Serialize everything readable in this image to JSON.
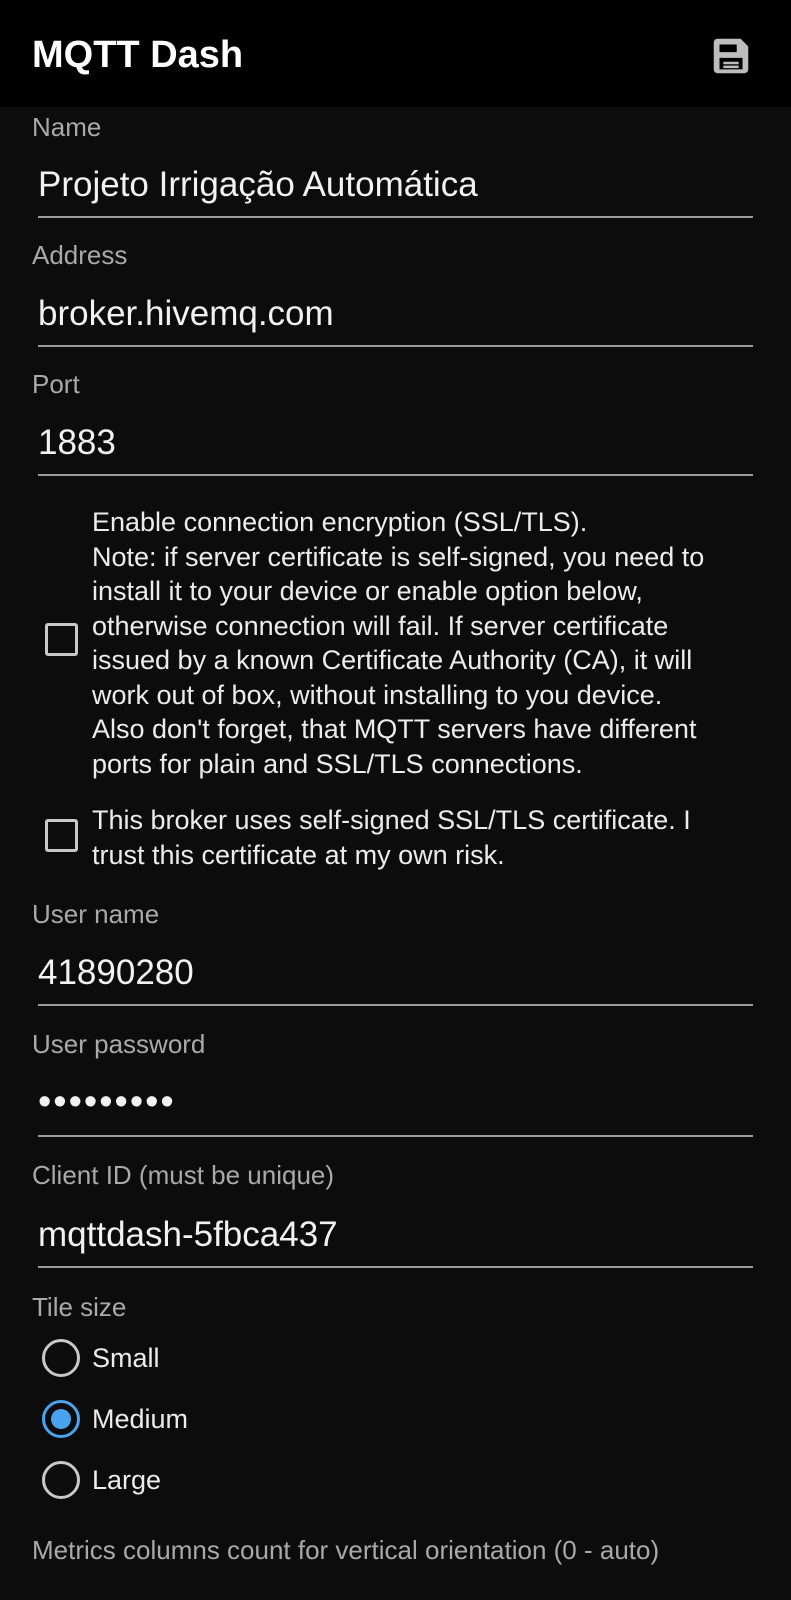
{
  "appbar": {
    "title": "MQTT Dash",
    "save_icon": "save-icon"
  },
  "form": {
    "name": {
      "label": "Name",
      "value": "Projeto Irrigação Automática"
    },
    "address": {
      "label": "Address",
      "value": "broker.hivemq.com"
    },
    "port": {
      "label": "Port",
      "value": "1883"
    },
    "ssl": {
      "checked": false,
      "lines": [
        "Enable connection encryption (SSL/TLS).",
        "Note: if server certificate is self-signed, you need to",
        "install it to your device or enable option below,",
        "otherwise connection will fail. If server certificate",
        "issued by a known Certificate Authority (CA), it will",
        "work out of box, without installing to you device.",
        "Also don't forget, that MQTT servers have different",
        "ports for plain and SSL/TLS connections."
      ]
    },
    "self_signed": {
      "checked": false,
      "lines": [
        "This broker uses self-signed SSL/TLS certificate. I",
        "trust this certificate at my own risk."
      ]
    },
    "username": {
      "label": "User name",
      "value": "41890280"
    },
    "password": {
      "label": "User password",
      "value": "•••••••••"
    },
    "client_id": {
      "label": "Client ID (must be unique)",
      "value": "mqttdash-5fbca437"
    },
    "tile_size": {
      "label": "Tile size",
      "options": [
        "Small",
        "Medium",
        "Large"
      ],
      "selected": "Medium"
    },
    "metrics_label": "Metrics columns count for vertical orientation (0 - auto)"
  },
  "colors": {
    "background": "#0c0c0c",
    "appbar": "#000000",
    "accent": "#4aa3ee",
    "label": "#a9a9a9",
    "underline": "#9a9a9a"
  }
}
